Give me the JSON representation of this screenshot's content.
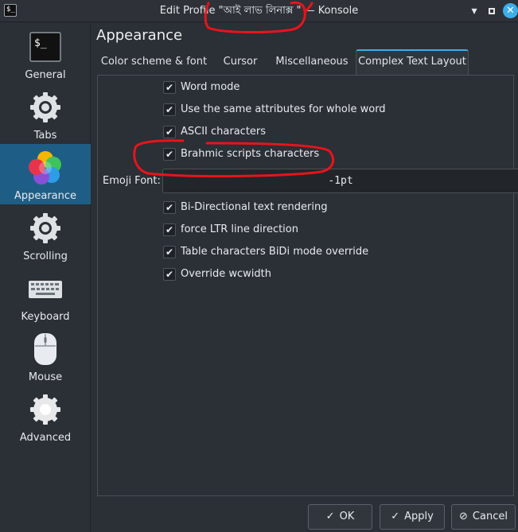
{
  "window": {
    "title": "Edit Profile \"আই লাভ লিনাক্স \" — Konsole",
    "app_icon_glyph": "$_",
    "close_glyph": "✕",
    "minimize_glyph": "▾",
    "close_button_color": "#3daee9"
  },
  "sidebar": {
    "items": [
      {
        "label": "General",
        "icon": "terminal-icon"
      },
      {
        "label": "Tabs",
        "icon": "gear-icon"
      },
      {
        "label": "Appearance",
        "icon": "color-palette-icon",
        "active": true
      },
      {
        "label": "Scrolling",
        "icon": "gear-icon"
      },
      {
        "label": "Keyboard",
        "icon": "keyboard-icon"
      },
      {
        "label": "Mouse",
        "icon": "mouse-icon"
      },
      {
        "label": "Advanced",
        "icon": "gear-icon"
      }
    ],
    "active_color": "#1e5e86"
  },
  "main": {
    "title": "Appearance",
    "tabs": [
      {
        "label": "Color scheme & font"
      },
      {
        "label": "Cursor"
      },
      {
        "label": "Miscellaneous"
      },
      {
        "label": "Complex Text Layout",
        "active": true
      }
    ],
    "checkboxes_top": [
      {
        "label": "Word mode",
        "checked": true
      },
      {
        "label": "Use the same attributes for whole word",
        "checked": true
      },
      {
        "label": "ASCII characters",
        "checked": true
      },
      {
        "label": "Brahmic scripts characters",
        "checked": true
      }
    ],
    "emoji_font": {
      "label": "Emoji Font:",
      "value": "-1pt"
    },
    "checkboxes_bottom": [
      {
        "label": "Bi-Directional text rendering",
        "checked": true
      },
      {
        "label": "force LTR line direction",
        "checked": true
      },
      {
        "label": "Table characters BiDi mode override",
        "checked": true
      },
      {
        "label": "Override wcwidth",
        "checked": true
      }
    ],
    "check_glyph": "✔"
  },
  "buttons": {
    "ok": {
      "label": "OK",
      "glyph": "✓"
    },
    "apply": {
      "label": "Apply",
      "glyph": "✓"
    },
    "cancel": {
      "label": "Cancel",
      "glyph": "⊘"
    }
  },
  "annotation_color": "#e8141a"
}
